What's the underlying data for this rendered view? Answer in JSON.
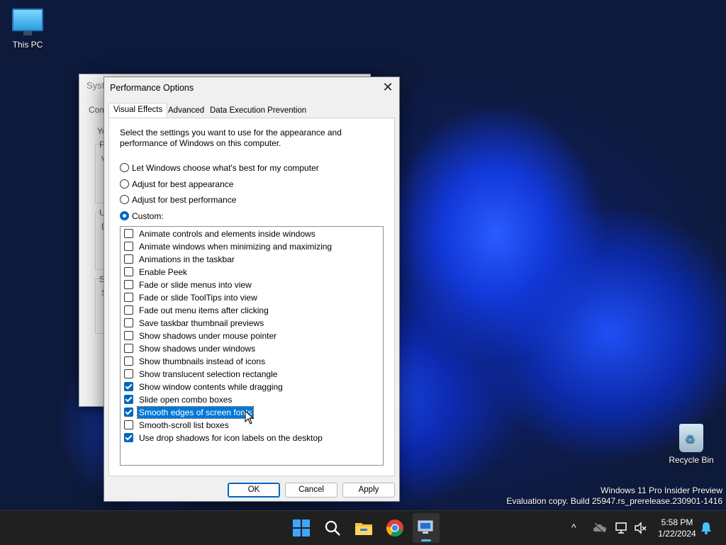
{
  "desktop": {
    "this_pc_label": "This PC",
    "recycle_bin_label": "Recycle Bin",
    "watermark_line1": "Windows 11 Pro Insider Preview",
    "watermark_line2": "Evaluation copy. Build 25947.rs_prerelease.230901-1416"
  },
  "background_window": {
    "title_fragment": "Syste",
    "tab_fragment": "Com",
    "frag_y": "Yo",
    "frag_p": "P",
    "frag_v": "V",
    "frag_u": "U",
    "frag_d": "D",
    "frag_s1": "S",
    "frag_s2": "S"
  },
  "dialog": {
    "title": "Performance Options",
    "close_glyph": "✕",
    "tabs": [
      "Visual Effects",
      "Advanced",
      "Data Execution Prevention"
    ],
    "active_tab": "Visual Effects",
    "description": "Select the settings you want to use for the appearance and performance of Windows on this computer.",
    "radios": [
      {
        "label": "Let Windows choose what's best for my computer",
        "checked": false
      },
      {
        "label": "Adjust for best appearance",
        "checked": false
      },
      {
        "label": "Adjust for best performance",
        "checked": false
      },
      {
        "label": "Custom:",
        "checked": true
      }
    ],
    "effects": [
      {
        "label": "Animate controls and elements inside windows",
        "checked": false
      },
      {
        "label": "Animate windows when minimizing and maximizing",
        "checked": false
      },
      {
        "label": "Animations in the taskbar",
        "checked": false
      },
      {
        "label": "Enable Peek",
        "checked": false
      },
      {
        "label": "Fade or slide menus into view",
        "checked": false
      },
      {
        "label": "Fade or slide ToolTips into view",
        "checked": false
      },
      {
        "label": "Fade out menu items after clicking",
        "checked": false
      },
      {
        "label": "Save taskbar thumbnail previews",
        "checked": false
      },
      {
        "label": "Show shadows under mouse pointer",
        "checked": false
      },
      {
        "label": "Show shadows under windows",
        "checked": false
      },
      {
        "label": "Show thumbnails instead of icons",
        "checked": false
      },
      {
        "label": "Show translucent selection rectangle",
        "checked": false
      },
      {
        "label": "Show window contents while dragging",
        "checked": true
      },
      {
        "label": "Slide open combo boxes",
        "checked": true
      },
      {
        "label": "Smooth edges of screen fonts",
        "checked": true,
        "selected": true
      },
      {
        "label": "Smooth-scroll list boxes",
        "checked": false
      },
      {
        "label": "Use drop shadows for icon labels on the desktop",
        "checked": true
      }
    ],
    "buttons": {
      "ok": "OK",
      "cancel": "Cancel",
      "apply": "Apply"
    }
  },
  "taskbar": {
    "time": "5:58 PM",
    "date": "1/22/2024",
    "tray_chevron": "^",
    "icons": [
      "start-icon",
      "search-icon",
      "file-explorer-icon",
      "chrome-icon",
      "system-properties-icon"
    ]
  },
  "colors": {
    "accent": "#0067c0",
    "selection": "#0078d7",
    "taskbar": "#202020"
  }
}
